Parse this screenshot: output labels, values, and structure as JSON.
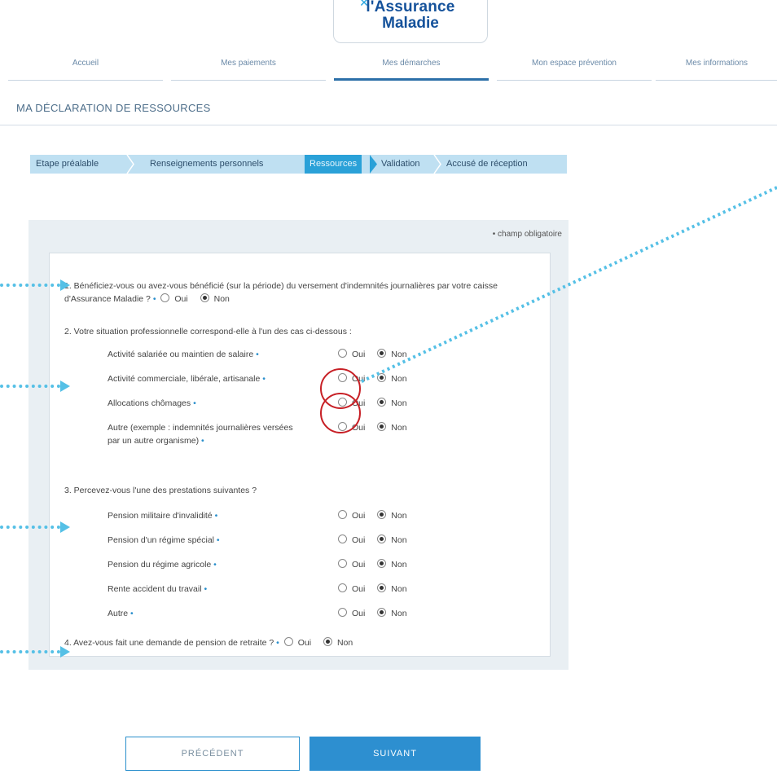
{
  "logo": {
    "line1": "l'Assurance",
    "line2": "Maladie"
  },
  "nav": [
    {
      "label": "Accueil"
    },
    {
      "label": "Mes paiements"
    },
    {
      "label": "Mes démarches"
    },
    {
      "label": "Mon espace prévention"
    },
    {
      "label": "Mes informations"
    }
  ],
  "page_title": "MA DÉCLARATION DE RESSOURCES",
  "steps": [
    {
      "label": "Etape préalable"
    },
    {
      "label": "Renseignements personnels"
    },
    {
      "label": "Ressources"
    },
    {
      "label": "Validation"
    },
    {
      "label": "Accusé de réception"
    }
  ],
  "required_note": "• champ obligatoire",
  "q1": {
    "text": "1.  Bénéficiez-vous ou avez-vous bénéficié (sur la période) du versement d'indemnités journalières par votre caisse d'Assurance Maladie ?",
    "answer": "Non"
  },
  "q2": {
    "text": "2.  Votre situation professionnelle correspond-elle à l'un des cas ci-dessous :",
    "items": [
      {
        "label": "Activité salariée ou maintien de salaire",
        "answer": "Non"
      },
      {
        "label": "Activité commerciale, libérale, artisanale",
        "answer": "Non"
      },
      {
        "label": "Allocations chômages",
        "answer": "Non"
      },
      {
        "label": "Autre (exemple : indemnités journalières versées par un autre organisme)",
        "answer": "Non"
      }
    ]
  },
  "q3": {
    "text": "3.  Percevez-vous l'une des prestations suivantes ?",
    "items": [
      {
        "label": "Pension militaire d'invalidité",
        "answer": "Non"
      },
      {
        "label": "Pension d'un régime spécial",
        "answer": "Non"
      },
      {
        "label": "Pension du régime agricole",
        "answer": "Non"
      },
      {
        "label": "Rente accident du travail",
        "answer": "Non"
      },
      {
        "label": "Autre",
        "answer": "Non"
      }
    ]
  },
  "q4": {
    "text": "4.  Avez-vous fait une demande de pension de retraite ?",
    "answer": "Non"
  },
  "options": {
    "yes": "Oui",
    "no": "Non"
  },
  "asterisk": "•",
  "buttons": {
    "prev": "PRÉCÉDENT",
    "next": "SUIVANT"
  },
  "colors": {
    "primary": "#2d8fd0",
    "annotation_arrow": "#55c0e6",
    "annotation_circle": "#c72026",
    "steps_bg": "#bfe0f2"
  }
}
